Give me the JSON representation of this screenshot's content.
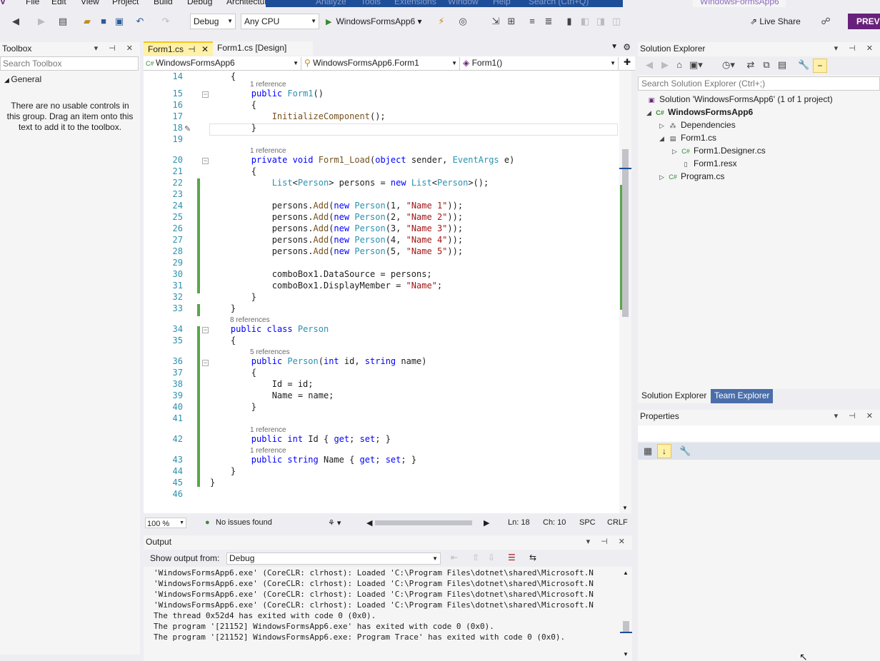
{
  "menu": {
    "items": [
      "File",
      "Edit",
      "View",
      "Project",
      "Build",
      "Debug",
      "Architecture",
      "Analyze",
      "Tools",
      "Extensions",
      "Window",
      "Help",
      "Search (Ctrl+Q)"
    ],
    "solution_name": "WindowsFormsApp6"
  },
  "toolbar": {
    "config": "Debug",
    "platform": "Any CPU",
    "start_label": "WindowsFormsApp6",
    "live_share": "Live Share",
    "preview": "PREVI"
  },
  "toolbox": {
    "title": "Toolbox",
    "search_placeholder": "Search Toolbox",
    "group": "General",
    "empty_message": "There are no usable controls in this group. Drag an item onto this text to add it to the toolbox."
  },
  "editor": {
    "tabs": [
      {
        "label": "Form1.cs",
        "pin": "⊣"
      },
      {
        "label": "Form1.cs [Design]"
      }
    ],
    "nav": {
      "project": "WindowsFormsApp6",
      "class": "WindowsFormsApp6.Form1",
      "member": "Form1()"
    },
    "code_lines": [
      {
        "n": "14",
        "text": "    {"
      },
      {
        "n": "15",
        "text": "        public Form1()"
      },
      {
        "n": "16",
        "text": "        {"
      },
      {
        "n": "17",
        "text": "            InitializeComponent();"
      },
      {
        "n": "18",
        "text": "        }"
      },
      {
        "n": "19",
        "text": ""
      },
      {
        "n": "20",
        "text": "        private void Form1_Load(object sender, EventArgs e)"
      },
      {
        "n": "21",
        "text": "        {"
      },
      {
        "n": "22",
        "text": "            List<Person> persons = new List<Person>();"
      },
      {
        "n": "23",
        "text": ""
      },
      {
        "n": "24",
        "text": "            persons.Add(new Person(1, \"Name 1\"));"
      },
      {
        "n": "25",
        "text": "            persons.Add(new Person(2, \"Name 2\"));"
      },
      {
        "n": "26",
        "text": "            persons.Add(new Person(3, \"Name 3\"));"
      },
      {
        "n": "27",
        "text": "            persons.Add(new Person(4, \"Name 4\"));"
      },
      {
        "n": "28",
        "text": "            persons.Add(new Person(5, \"Name 5\"));"
      },
      {
        "n": "29",
        "text": ""
      },
      {
        "n": "30",
        "text": "            comboBox1.DataSource = persons;"
      },
      {
        "n": "31",
        "text": "            comboBox1.DisplayMember = \"Name\";"
      },
      {
        "n": "32",
        "text": "        }"
      },
      {
        "n": "33",
        "text": "    }"
      },
      {
        "n": "34",
        "text": "    public class Person"
      },
      {
        "n": "35",
        "text": "    {"
      },
      {
        "n": "36",
        "text": "        public Person(int id, string name)"
      },
      {
        "n": "37",
        "text": "        {"
      },
      {
        "n": "38",
        "text": "            Id = id;"
      },
      {
        "n": "39",
        "text": "            Name = name;"
      },
      {
        "n": "40",
        "text": "        }"
      },
      {
        "n": "41",
        "text": ""
      },
      {
        "n": "42",
        "text": "        public int Id { get; set; }"
      },
      {
        "n": "43",
        "text": "        public string Name { get; set; }"
      },
      {
        "n": "44",
        "text": "    }"
      },
      {
        "n": "45",
        "text": "}"
      },
      {
        "n": "46",
        "text": ""
      }
    ],
    "references": {
      "r15": "1 reference",
      "r20": "1 reference",
      "r34": "8 references",
      "r36": "5 references",
      "r42": "1 reference",
      "r43": "1 reference"
    },
    "status": {
      "zoom": "100 %",
      "issues": "No issues found",
      "ln": "Ln: 18",
      "ch": "Ch: 10",
      "spc": "SPC",
      "crlf": "CRLF"
    }
  },
  "output": {
    "title": "Output",
    "show_from_label": "Show output from:",
    "source": "Debug",
    "lines": [
      "'WindowsFormsApp6.exe' (CoreCLR: clrhost): Loaded 'C:\\Program Files\\dotnet\\shared\\Microsoft.N",
      "'WindowsFormsApp6.exe' (CoreCLR: clrhost): Loaded 'C:\\Program Files\\dotnet\\shared\\Microsoft.N",
      "'WindowsFormsApp6.exe' (CoreCLR: clrhost): Loaded 'C:\\Program Files\\dotnet\\shared\\Microsoft.N",
      "'WindowsFormsApp6.exe' (CoreCLR: clrhost): Loaded 'C:\\Program Files\\dotnet\\shared\\Microsoft.N",
      "The thread 0x52d4 has exited with code 0 (0x0).",
      "The program '[21152] WindowsFormsApp6.exe' has exited with code 0 (0x0).",
      "The program '[21152] WindowsFormsApp6.exe: Program Trace' has exited with code 0 (0x0)."
    ]
  },
  "solution_explorer": {
    "title": "Solution Explorer",
    "search_placeholder": "Search Solution Explorer (Ctrl+;)",
    "items": [
      {
        "label": "Solution 'WindowsFormsApp6' (1 of 1 project)"
      },
      {
        "label": "WindowsFormsApp6"
      },
      {
        "label": "Dependencies"
      },
      {
        "label": "Form1.cs"
      },
      {
        "label": "Form1.Designer.cs"
      },
      {
        "label": "Form1.resx"
      },
      {
        "label": "Program.cs"
      }
    ],
    "tabs": [
      "Solution Explorer",
      "Team Explorer"
    ]
  },
  "properties": {
    "title": "Properties"
  },
  "colors": {
    "accent_purple": "#68217a",
    "selected_tab": "#fff1a8",
    "change_bar": "#57a64a"
  }
}
